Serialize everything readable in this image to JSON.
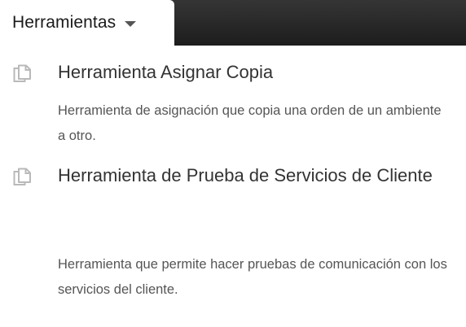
{
  "menu": {
    "title": "Herramientas",
    "items": [
      {
        "icon": "copy-icon",
        "title": "Herramienta Asignar Copia",
        "description": "Herramienta de asignación que copia una orden de un ambiente a otro."
      },
      {
        "icon": "copy-icon",
        "title": "Herramienta de Prueba de Servicios de Cliente",
        "description": "Herramienta que permite hacer pruebas de comunicación con los servicios del cliente."
      }
    ]
  }
}
